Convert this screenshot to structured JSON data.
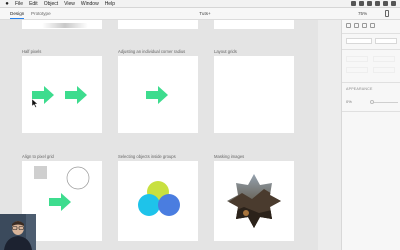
{
  "menubar": {
    "items": [
      "File",
      "Edit",
      "Object",
      "View",
      "Window",
      "Help"
    ]
  },
  "toolbar": {
    "modes": [
      "Design",
      "Prototype"
    ],
    "active_mode": "Design",
    "document_title": "Tuts+",
    "zoom": "75%"
  },
  "panel": {
    "appearance_label": "APPEARANCE",
    "opacity_value": "0%"
  },
  "artboards": [
    {
      "title": "Half pixels"
    },
    {
      "title": "Adjusting an individual corner radius"
    },
    {
      "title": "Layout grids"
    },
    {
      "title": "Align to pixel grid"
    },
    {
      "title": "Selecting objects inside groups"
    },
    {
      "title": "Masking images"
    }
  ],
  "colors": {
    "arrow_green": "#3ddc8e",
    "circle_yellow": "#c8e040",
    "circle_cyan": "#1ec3ea",
    "circle_blue": "#4a7de0",
    "accent_blue": "#2680eb"
  },
  "icons": {
    "device": "phone-icon",
    "cursor": "pointer-cursor-icon"
  }
}
